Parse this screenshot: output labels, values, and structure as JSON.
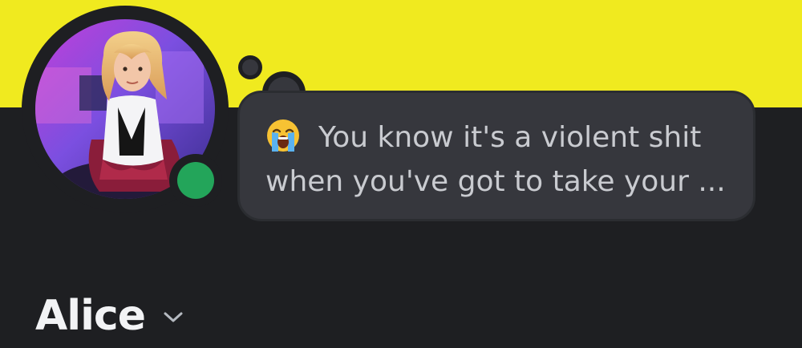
{
  "banner": {
    "color": "#f0ea1f"
  },
  "profile": {
    "username": "Alice",
    "status": {
      "name": "online",
      "color": "#23a55a"
    }
  },
  "custom_status": {
    "emoji": "loudly-crying-face-icon",
    "line1": "You know it's a violent shit",
    "line2": "when you've got to take your ..."
  },
  "icons": {
    "avatar": "avatar-image",
    "chevron": "chevron-down-icon"
  }
}
